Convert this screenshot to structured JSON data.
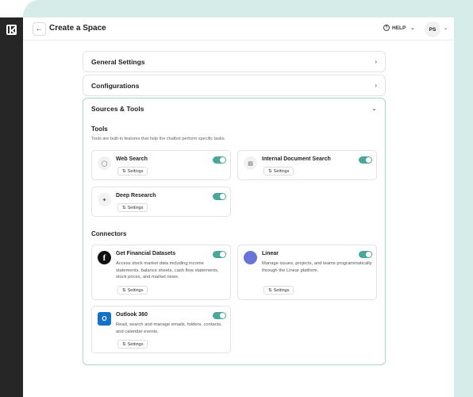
{
  "header": {
    "back_icon": "arrow-left-icon",
    "title": "Create a Space",
    "help_label": "HELP",
    "help_icon": "question-circle-icon",
    "avatar_initials": "PS"
  },
  "sections": {
    "general": {
      "title": "General Settings"
    },
    "configurations": {
      "title": "Configurations"
    },
    "sources": {
      "title": "Sources & Tools"
    }
  },
  "tools": {
    "title": "Tools",
    "description": "Tools are built-in features that help the chatbot perform specific tasks.",
    "items": [
      {
        "name": "Web Search",
        "icon": "globe-icon",
        "settings_label": "Settings",
        "enabled": true
      },
      {
        "name": "Internal Document Search",
        "icon": "document-search-icon",
        "settings_label": "Settings",
        "enabled": true
      },
      {
        "name": "Deep Research",
        "icon": "telescope-icon",
        "settings_label": "Settings",
        "enabled": true
      }
    ]
  },
  "connectors": {
    "title": "Connectors",
    "items": [
      {
        "name": "Get Financial Datasets",
        "icon": "financial-datasets-logo",
        "description": "Access stock market data including income statements, balance sheets, cash flow statements, stock prices, and market news.",
        "settings_label": "Settings",
        "enabled": true
      },
      {
        "name": "Linear",
        "icon": "linear-logo",
        "description": "Manage issues, projects, and teams programmatically through the Linear platform.",
        "settings_label": "Settings",
        "enabled": true
      },
      {
        "name": "Outlook 360",
        "icon": "outlook-logo",
        "description": "Read, search and manage emails, folders, contacts, and calendar events.",
        "settings_label": "Settings",
        "enabled": true
      }
    ]
  },
  "colors": {
    "accent": "#4aa79a",
    "mint_background": "#d6ece8",
    "rail": "#262626"
  }
}
